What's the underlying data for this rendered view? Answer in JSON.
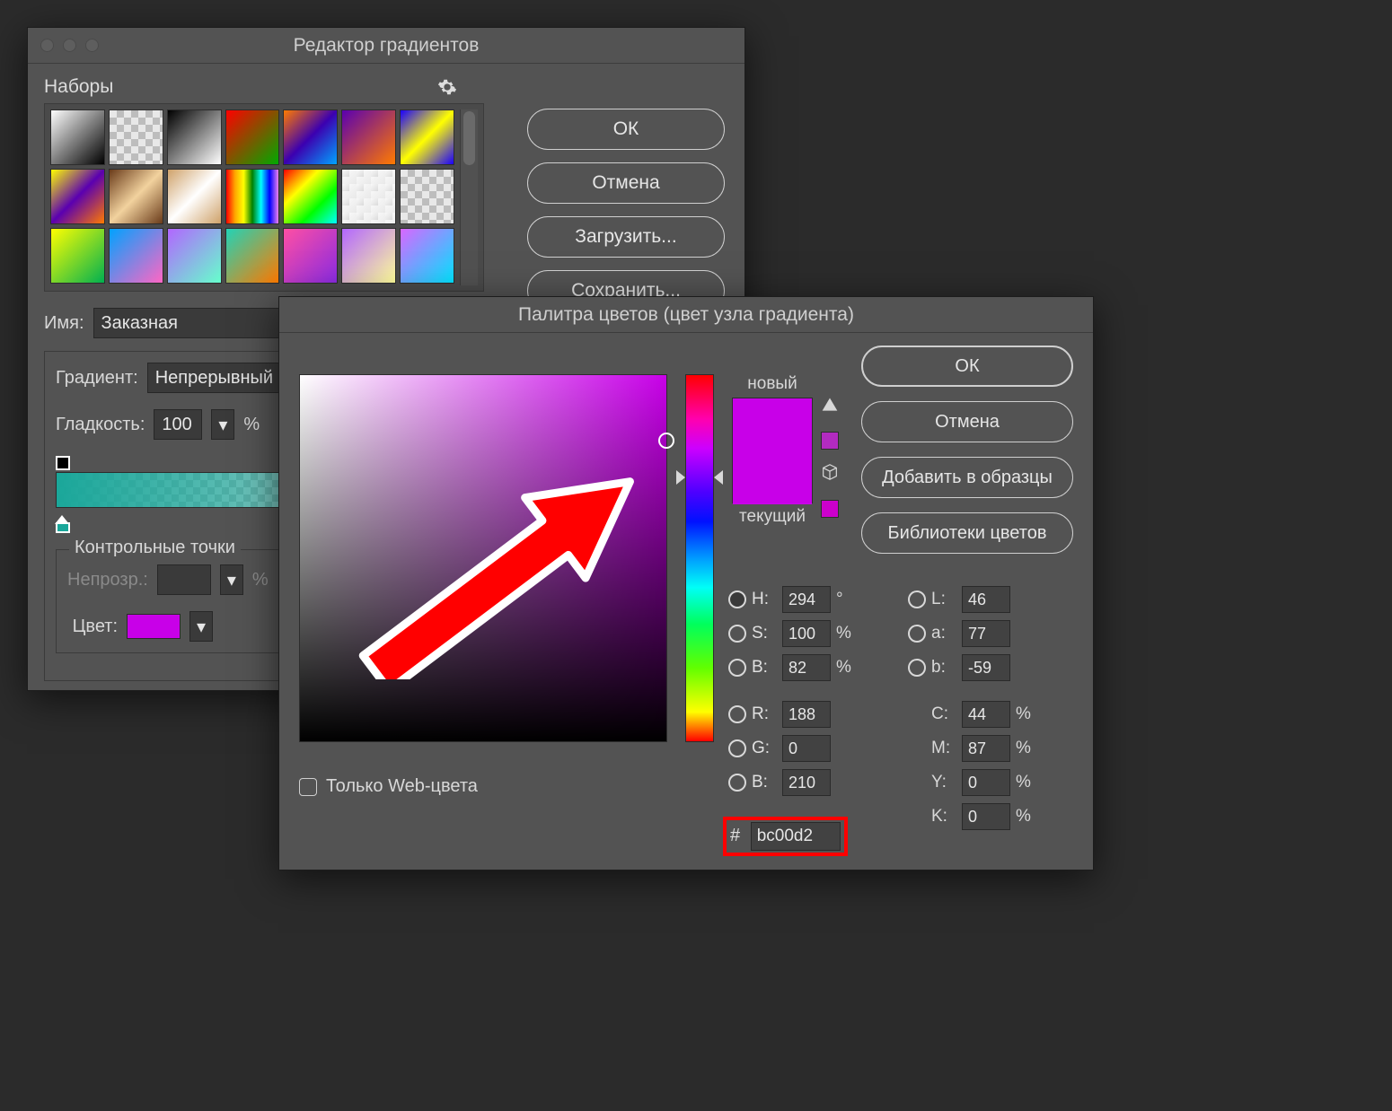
{
  "gradient_editor": {
    "title": "Редактор градиентов",
    "presets_label": "Наборы",
    "buttons": {
      "ok": "ОК",
      "cancel": "Отмена",
      "load": "Загрузить...",
      "save": "Сохранить..."
    },
    "name_label": "Имя:",
    "name_value": "Заказная",
    "type_label": "Градиент:",
    "type_value": "Непрерывный",
    "smooth_label": "Гладкость:",
    "smooth_value": "100",
    "smooth_unit": "%",
    "stops_panel_title": "Контрольные точки",
    "opacity_label": "Непрозр.:",
    "opacity_unit": "%",
    "color_label": "Цвет:",
    "stop_color": "#c800e8",
    "bar_start_color": "#1aa79a"
  },
  "color_picker": {
    "title": "Палитра цветов (цвет узла градиента)",
    "new_label": "новый",
    "current_label": "текущий",
    "new_color": "#c800e8",
    "current_color": "#c800e8",
    "buttons": {
      "ok": "ОК",
      "cancel": "Отмена",
      "add": "Добавить в образцы",
      "libs": "Библиотеки цветов"
    },
    "web_only_label": "Только Web-цвета",
    "hsb": {
      "h": "294",
      "h_unit": "°",
      "s": "100",
      "s_unit": "%",
      "b": "82",
      "b_unit": "%"
    },
    "lab": {
      "l": "46",
      "a": "77",
      "b2": "-59"
    },
    "rgb": {
      "r": "188",
      "g": "0",
      "b": "210"
    },
    "cmyk": {
      "c": "44",
      "m": "87",
      "y": "0",
      "k": "0",
      "unit": "%"
    },
    "hex_label": "#",
    "hex_value": "bc00d2",
    "labels": {
      "H": "H:",
      "S": "S:",
      "B": "B:",
      "L": "L:",
      "a": "a:",
      "b": "b:",
      "R": "R:",
      "G": "G:",
      "Bv": "B:",
      "C": "C:",
      "M": "M:",
      "Y": "Y:",
      "K": "K:"
    }
  }
}
